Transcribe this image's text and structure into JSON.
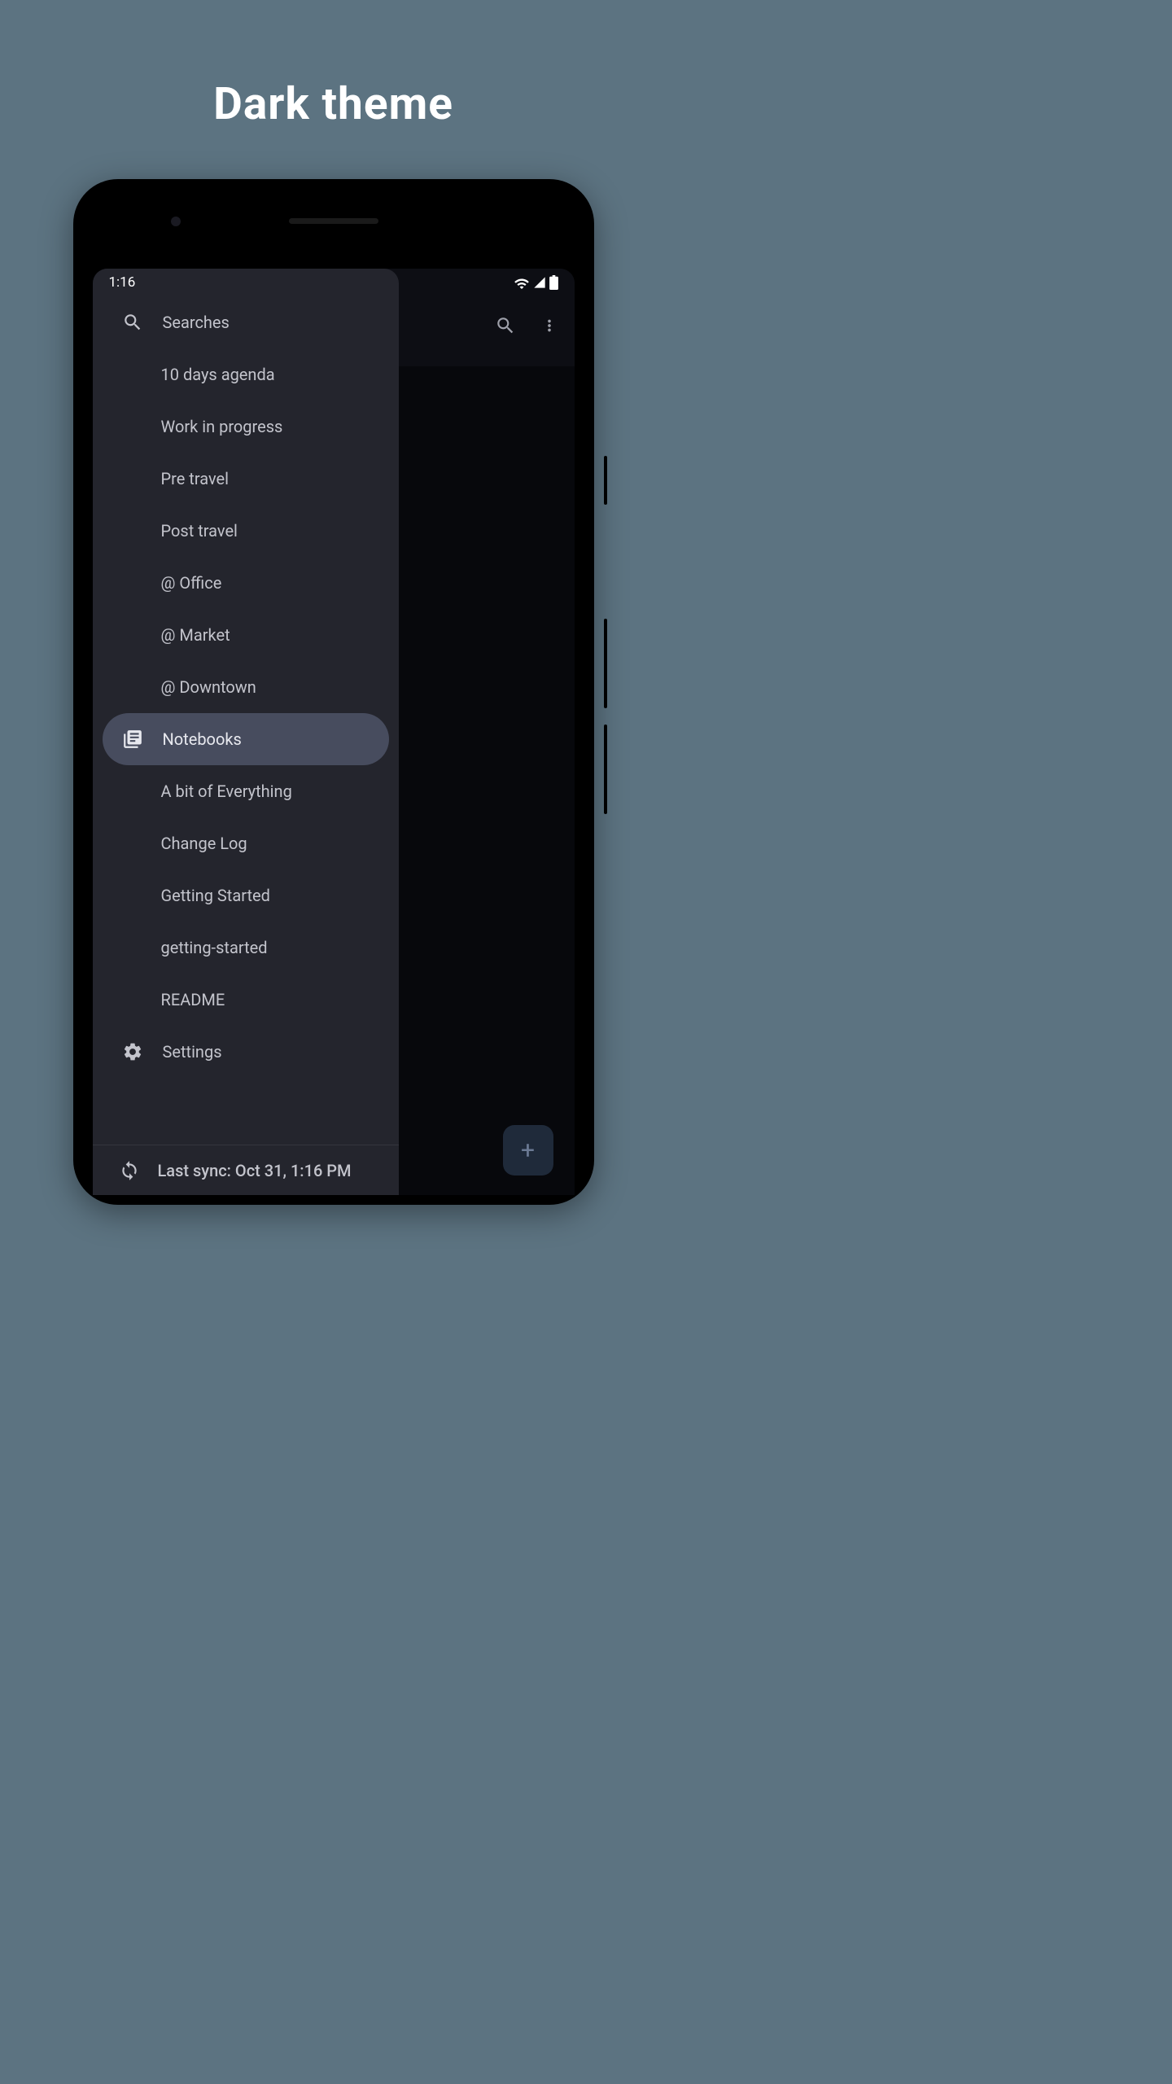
{
  "title": "Dark theme",
  "status": {
    "time": "1:16"
  },
  "drawer": {
    "searches": {
      "label": "Searches",
      "items": [
        {
          "label": "10 days agenda"
        },
        {
          "label": "Work in progress"
        },
        {
          "label": "Pre travel"
        },
        {
          "label": "Post travel"
        },
        {
          "label": "@ Office"
        },
        {
          "label": "@ Market"
        },
        {
          "label": "@ Downtown"
        }
      ]
    },
    "notebooks": {
      "label": "Notebooks",
      "items": [
        {
          "label": "A bit of Everything"
        },
        {
          "label": "Change Log"
        },
        {
          "label": "Getting Started"
        },
        {
          "label": "getting-started"
        },
        {
          "label": "README"
        }
      ]
    },
    "settings_label": "Settings",
    "sync_label": "Last sync: Oct 31, 1:16 PM"
  },
  "fab_label": "+"
}
